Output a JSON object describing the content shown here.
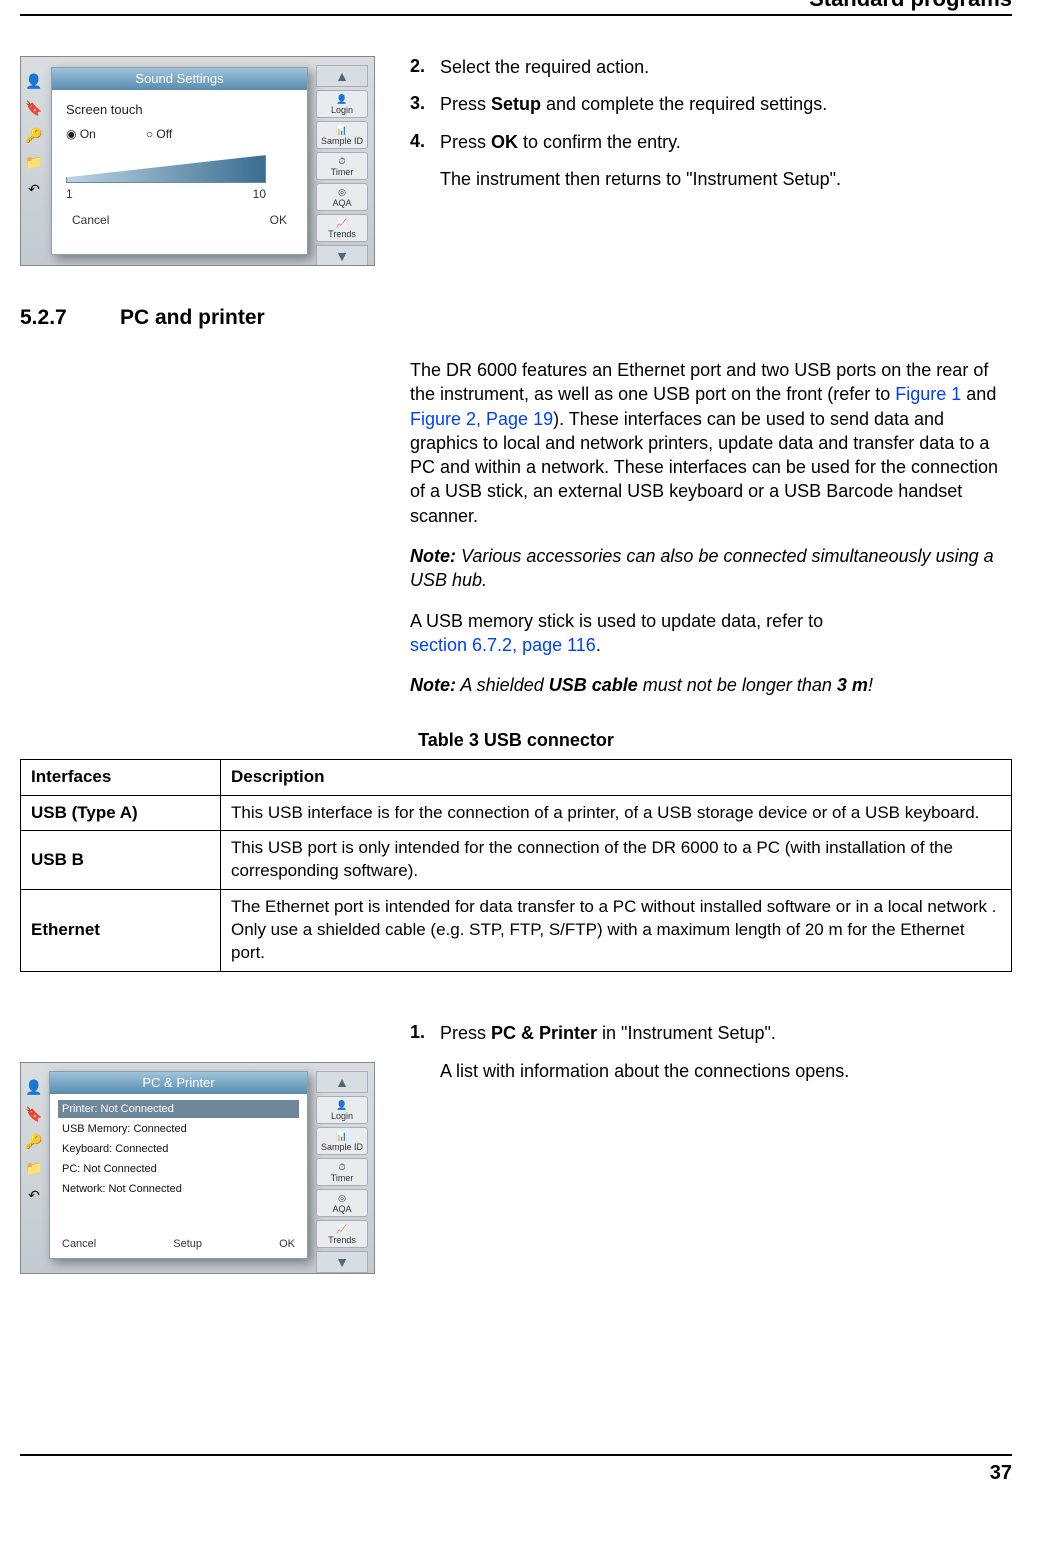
{
  "header": {
    "title": "Standard programs"
  },
  "footer": {
    "page": "37"
  },
  "figure1": {
    "dialog_title": "Sound Settings",
    "label_screen_touch": "Screen touch",
    "radio_on": "On",
    "radio_off": "Off",
    "scale_min": "1",
    "scale_max": "10",
    "btn_cancel": "Cancel",
    "btn_ok": "OK",
    "side": {
      "login": "Login",
      "sampleid": "Sample ID",
      "timer": "Timer",
      "aqa": "AQA",
      "trends": "Trends"
    }
  },
  "instructions1": {
    "i2": {
      "num": "2.",
      "text_a": "Select the required action."
    },
    "i3": {
      "num": "3.",
      "text_a": "Press ",
      "bold": "Setup",
      "text_b": " and complete the required settings."
    },
    "i4": {
      "num": "4.",
      "text_a": "Press ",
      "bold": "OK",
      "text_b": " to confirm the entry."
    },
    "post": "The instrument then returns to \"Instrument Setup\"."
  },
  "section": {
    "num": "5.2.7",
    "title": "PC and printer"
  },
  "para1": {
    "a": "The DR 6000 features an Ethernet port and two USB ports on the rear of the instrument, as well as one USB port on the front (refer to ",
    "link1": "Figure 1",
    "mid": " and ",
    "link2": "Figure 2, Page 19",
    "b": "). These interfaces can be used to send data and graphics to local and network printers, update data and transfer data to a PC and within a network. These interfaces can be used for the connection of a USB stick, an external USB keyboard or a USB Barcode handset scanner."
  },
  "note1": {
    "label": "Note:",
    "text": " Various accessories can also be connected simultaneously using a USB hub."
  },
  "para2": {
    "a": "A USB memory stick is used to update data, refer to ",
    "link": "section 6.7.2, page 116",
    "b": "."
  },
  "note2": {
    "label": "Note:",
    "a": " A shielded ",
    "bold": "USB cable",
    "b": " must not be longer than  ",
    "bold2": "3 m",
    "c": "!"
  },
  "table": {
    "caption": "Table 3 USB connector",
    "h1": "Interfaces",
    "h2": "Description",
    "rows": [
      {
        "iface": "USB (Type A)",
        "desc": "This USB interface is for the connection of a printer, of a USB storage device or of a USB keyboard."
      },
      {
        "iface": "USB B",
        "desc": "This USB port is only intended for the connection of the DR 6000 to a PC (with installation of the corresponding software)."
      },
      {
        "iface": "Ethernet",
        "desc": "The Ethernet port is intended for data transfer to a PC without installed software or in a local network  . Only use a shielded cable (e.g. STP, FTP, S/FTP) with a maximum length of 20 m for the Ethernet port."
      }
    ]
  },
  "figure2": {
    "dialog_title": "PC & Printer",
    "rows": [
      "Printer: Not Connected",
      "USB Memory: Connected",
      "Keyboard: Connected",
      "PC: Not Connected",
      "Network: Not Connected"
    ],
    "btn_cancel": "Cancel",
    "btn_setup": "Setup",
    "btn_ok": "OK",
    "side": {
      "login": "Login",
      "sampleid": "Sample ID",
      "timer": "Timer",
      "aqa": "AQA",
      "trends": "Trends"
    }
  },
  "instructions2": {
    "i1": {
      "num": "1.",
      "text_a": "Press ",
      "bold": "PC & Printer",
      "text_b": " in \"Instrument Setup\"."
    },
    "post": "A list with information about the connections opens."
  }
}
